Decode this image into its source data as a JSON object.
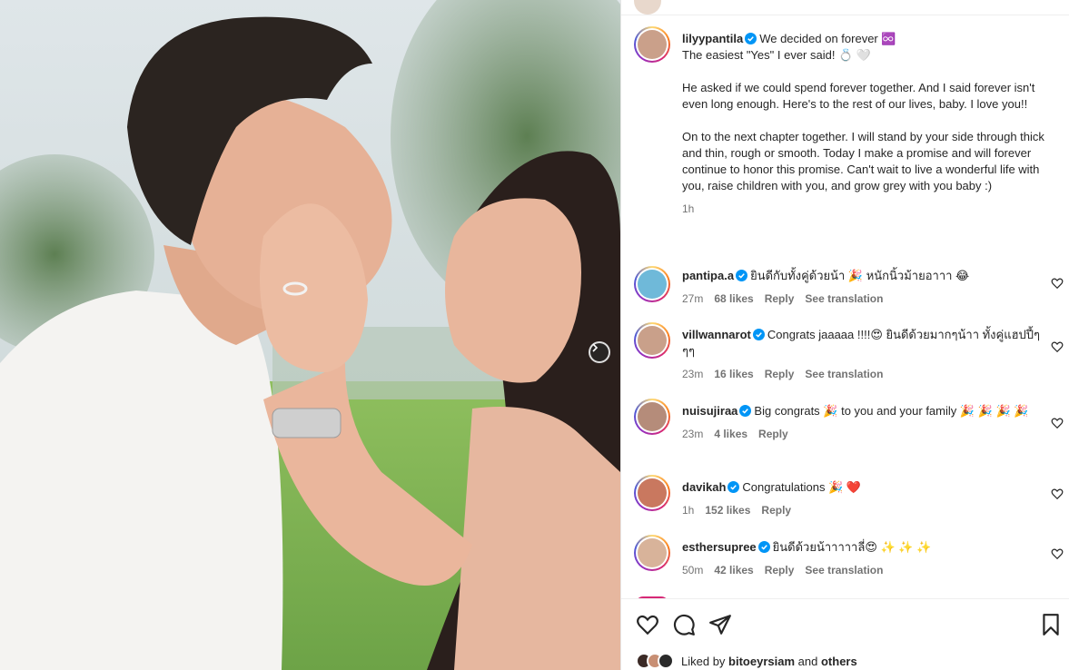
{
  "post": {
    "author": "lilyypantila",
    "caption_lines": [
      "We decided on forever ♾️",
      "The easiest \"Yes\" I ever said! 💍 🤍"
    ],
    "paragraph_1": "He asked if we could spend forever together. And I said forever isn't even long enough. Here's to the rest of our lives, baby. I love you!!",
    "paragraph_2": "On to the next chapter together. I will stand by your side through thick and thin, rough or smooth. Today I make a promise and will forever continue to honor this promise. Can't wait to live a wonderful life with you, raise children with you, and grow grey with you baby :)",
    "time": "1h"
  },
  "comments": [
    {
      "user": "pantipa.a",
      "text": "ยินดีกับทั้งคู่ด้วยน้า 🎉 หนักนิ้วม้ายอาาา 😂",
      "time": "27m",
      "likes": "68 likes",
      "reply": "Reply",
      "translate": "See translation",
      "avatar_color": "#6fb9d9"
    },
    {
      "user": "villwannarot",
      "text": "Congrats jaaaaa !!!!😍 ยินดีด้วยมากๆน้าา ทั้งคู่แฮปปี้ๆๆๆ",
      "time": "23m",
      "likes": "16 likes",
      "reply": "Reply",
      "translate": "See translation",
      "avatar_color": "#c9a08a"
    },
    {
      "user": "nuisujiraa",
      "text": "Big congrats 🎉 to you and your family 🎉 🎉 🎉 🎉",
      "time": "23m",
      "likes": "4 likes",
      "reply": "Reply",
      "translate": "",
      "avatar_color": "#b58c7a"
    },
    {
      "user": "davikah",
      "text": "Congratulations 🎉 ❤️",
      "time": "1h",
      "likes": "152 likes",
      "reply": "Reply",
      "translate": "",
      "avatar_color": "#c9785f"
    },
    {
      "user": "esthersupree",
      "text": "ยินดีด้วยน้าาาาาลี่😍 ✨ ✨ ✨",
      "time": "50m",
      "likes": "42 likes",
      "reply": "Reply",
      "translate": "See translation",
      "avatar_color": "#d8b39a"
    }
  ],
  "liked_by": {
    "prefix": "Liked by",
    "user": "bitoeyrsiam",
    "and": "and",
    "others": "others"
  },
  "icons": {
    "like": "heart-icon",
    "comment": "comment-icon",
    "share": "send-icon",
    "save": "bookmark-icon",
    "next": "chevron-right-icon",
    "verified": "verified-badge-icon"
  },
  "colors": {
    "verified": "#0095f6",
    "meta": "#737373",
    "text": "#262626"
  }
}
